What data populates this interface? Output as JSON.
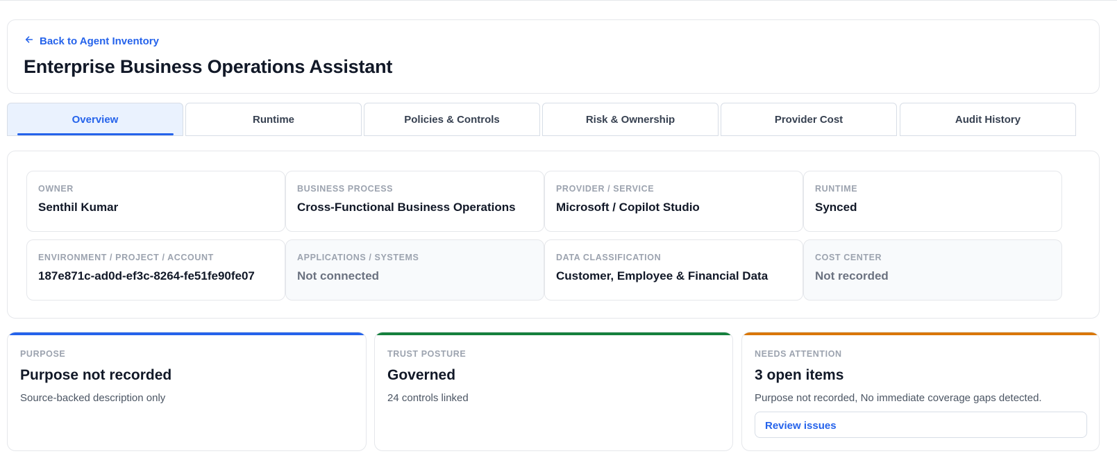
{
  "header": {
    "back_link": "Back to Agent Inventory",
    "title": "Enterprise Business Operations Assistant"
  },
  "tabs": [
    {
      "label": "Overview",
      "active": true
    },
    {
      "label": "Runtime",
      "active": false
    },
    {
      "label": "Policies & Controls",
      "active": false
    },
    {
      "label": "Risk & Ownership",
      "active": false
    },
    {
      "label": "Provider Cost",
      "active": false
    },
    {
      "label": "Audit History",
      "active": false
    }
  ],
  "fields": [
    {
      "label": "OWNER",
      "value": "Senthil Kumar"
    },
    {
      "label": "BUSINESS PROCESS",
      "value": "Cross-Functional Business Operations"
    },
    {
      "label": "PROVIDER / SERVICE",
      "value": "Microsoft / Copilot Studio"
    },
    {
      "label": "RUNTIME",
      "value": "Synced"
    },
    {
      "label": "ENVIRONMENT / PROJECT / ACCOUNT",
      "value": "187e871c-ad0d-ef3c-8264-fe51fe90fe07"
    },
    {
      "label": "APPLICATIONS / SYSTEMS",
      "value": "Not connected"
    },
    {
      "label": "DATA CLASSIFICATION",
      "value": "Customer, Employee & Financial Data"
    },
    {
      "label": "COST CENTER",
      "value": "Not recorded"
    }
  ],
  "stats": {
    "purpose": {
      "label": "PURPOSE",
      "value": "Purpose not recorded",
      "desc": "Source-backed description only",
      "accent": "#2563eb"
    },
    "trust": {
      "label": "TRUST POSTURE",
      "value": "Governed",
      "desc": "24 controls linked",
      "accent": "#15803d"
    },
    "attention": {
      "label": "NEEDS ATTENTION",
      "value": "3 open items",
      "desc": "Purpose not recorded, No immediate coverage gaps detected.",
      "button": "Review issues",
      "accent": "#d97706"
    }
  },
  "colors": {
    "link": "#2563eb",
    "active_tab_bg": "#eaf2fe",
    "border": "#e5e7eb"
  }
}
